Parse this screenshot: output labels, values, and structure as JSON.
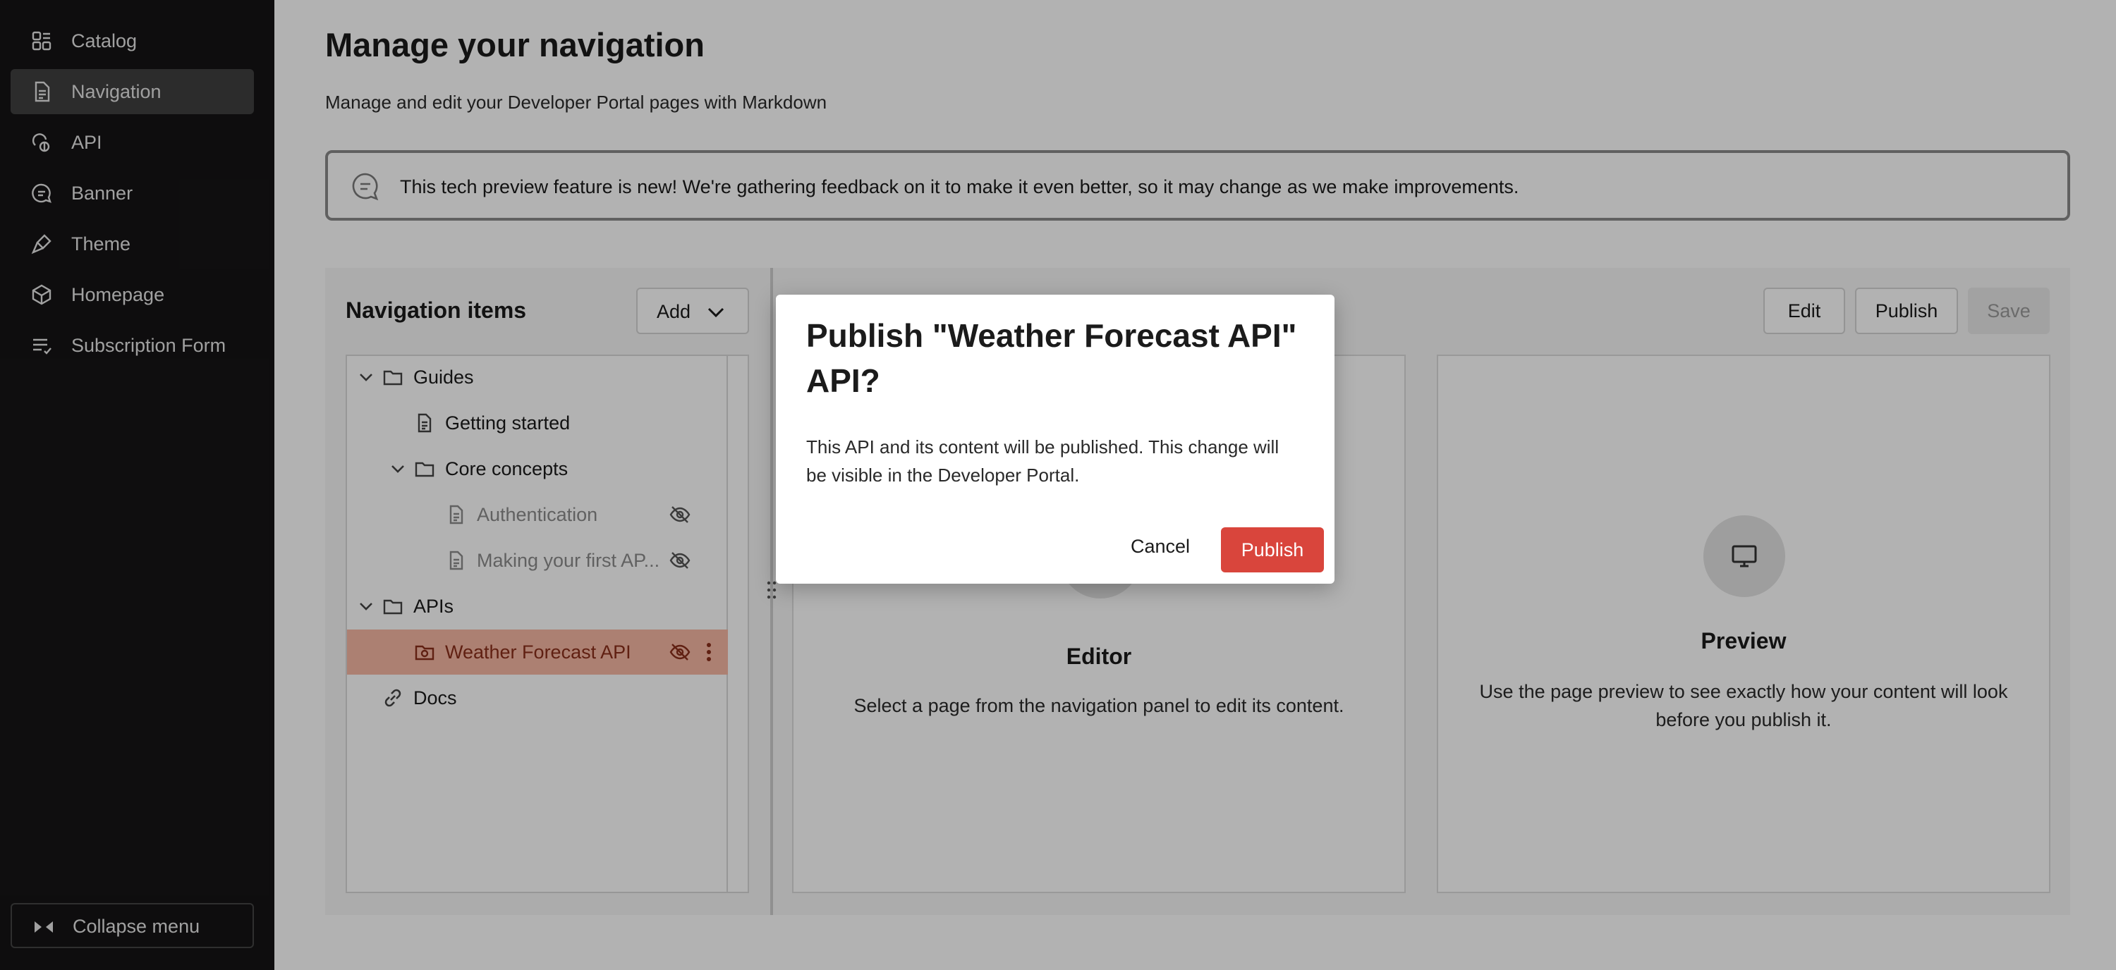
{
  "sidebar": {
    "items": [
      {
        "label": "Catalog",
        "icon": "catalog-icon"
      },
      {
        "label": "Navigation",
        "icon": "document-icon",
        "active": true
      },
      {
        "label": "API",
        "icon": "api-icon"
      },
      {
        "label": "Banner",
        "icon": "chat-bubble-icon"
      },
      {
        "label": "Theme",
        "icon": "brush-icon"
      },
      {
        "label": "Homepage",
        "icon": "cube-icon"
      },
      {
        "label": "Subscription Form",
        "icon": "form-list-icon"
      }
    ],
    "collapse_label": "Collapse menu"
  },
  "header": {
    "title": "Manage your navigation",
    "subtitle": "Manage and edit your Developer Portal pages with Markdown"
  },
  "notice": {
    "text": "This tech preview feature is new! We're gathering feedback on it to make it even better, so it may change as we make improvements."
  },
  "nav_panel": {
    "title": "Navigation items",
    "add_label": "Add",
    "items": [
      {
        "label": "Guides",
        "type": "folder",
        "expanded": true
      },
      {
        "label": "Getting started",
        "type": "page"
      },
      {
        "label": "Core concepts",
        "type": "folder",
        "expanded": true
      },
      {
        "label": "Authentication",
        "type": "page",
        "hidden": true
      },
      {
        "label": "Making your first AP...",
        "type": "page",
        "hidden": true
      },
      {
        "label": "APIs",
        "type": "folder",
        "expanded": true
      },
      {
        "label": "Weather Forecast API",
        "type": "api",
        "hidden": true,
        "selected": true
      },
      {
        "label": "Docs",
        "type": "link"
      }
    ]
  },
  "toolbar": {
    "edit_label": "Edit",
    "publish_label": "Publish",
    "save_label": "Save"
  },
  "editor_card": {
    "title": "Editor",
    "description": "Select a page from the navigation panel to edit its content."
  },
  "preview_card": {
    "title": "Preview",
    "description": "Use the page preview to see exactly how your content will look before you publish it."
  },
  "dialog": {
    "title": "Publish \"Weather Forecast API\" API?",
    "body": "This API and its content will be published. This change will be visible in the Developer Portal.",
    "cancel_label": "Cancel",
    "publish_label": "Publish"
  },
  "colors": {
    "sidebar_bg": "#151415",
    "sidebar_active": "#403f40",
    "selected_row": "#f7b8a4",
    "primary_button": "#d9453c"
  }
}
